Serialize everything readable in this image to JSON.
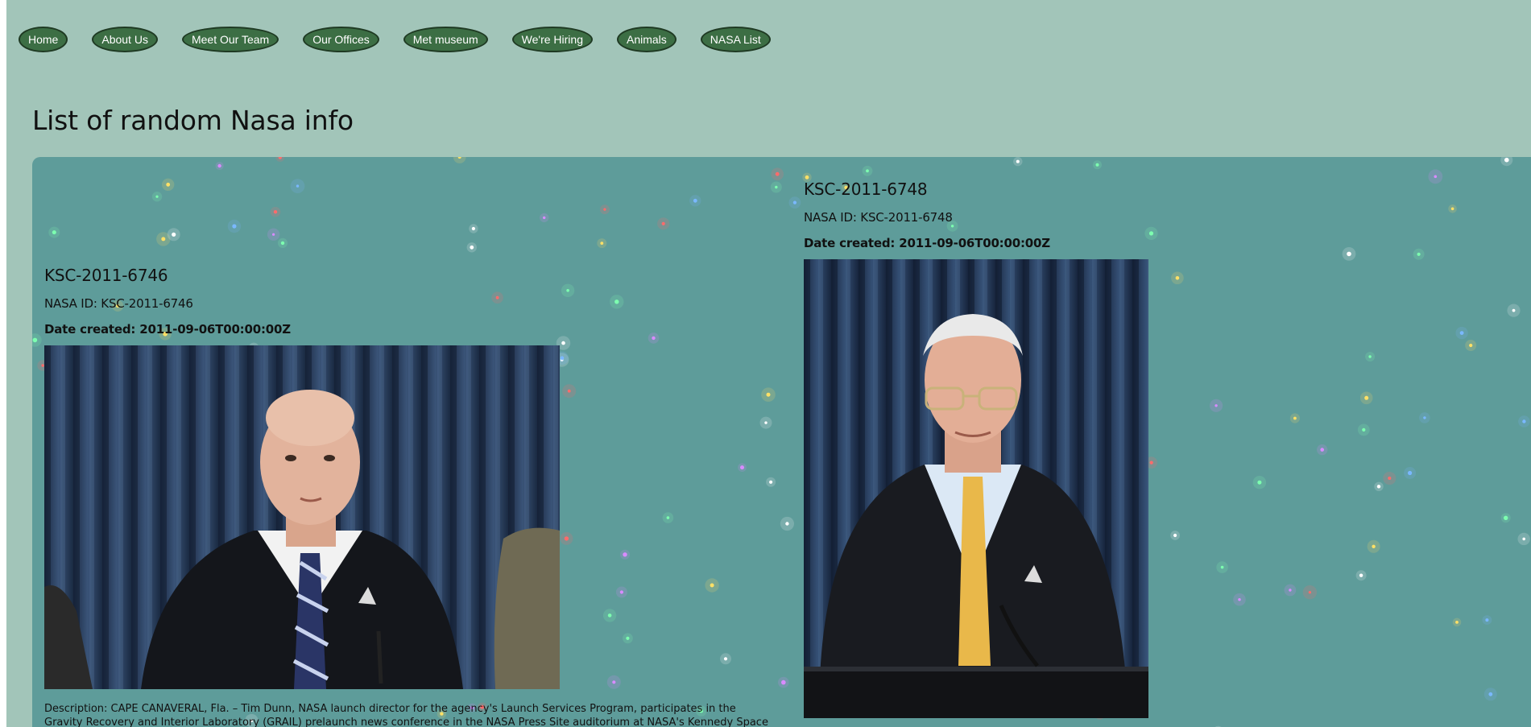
{
  "nav": {
    "items": [
      {
        "label": "Home",
        "name": "nav-home"
      },
      {
        "label": "About Us",
        "name": "nav-about-us"
      },
      {
        "label": "Meet Our Team",
        "name": "nav-meet-our-team"
      },
      {
        "label": "Our Offices",
        "name": "nav-our-offices"
      },
      {
        "label": "Met museum",
        "name": "nav-met-museum"
      },
      {
        "label": "We're Hiring",
        "name": "nav-were-hiring"
      },
      {
        "label": "Animals",
        "name": "nav-animals"
      },
      {
        "label": "NASA List",
        "name": "nav-nasa-list"
      }
    ]
  },
  "page": {
    "title": "List of random Nasa info"
  },
  "cards": [
    {
      "title": "KSC-2011-6746",
      "nasa_id": "NASA ID: KSC-2011-6746",
      "date_created": "Date created: 2011-09-06T00:00:00Z",
      "description": "Description: CAPE CANAVERAL, Fla. – Tim Dunn, NASA launch director for the agency's Launch Services Program, participates in the Gravity Recovery and Interior Laboratory (GRAIL) prelaunch news conference in the NASA Press Site auditorium at NASA's Kennedy Space Center in"
    },
    {
      "title": "KSC-2011-6748",
      "nasa_id": "NASA ID: KSC-2011-6748",
      "date_created": "Date created: 2011-09-06T00:00:00Z"
    }
  ],
  "colors": {
    "background": "#a2c5b9",
    "panel": "#5e9c9a",
    "nav_button": "#3c6e44",
    "sparkle_palette": [
      "#ffffff",
      "#7dffb0",
      "#ffe066",
      "#ff6b6b",
      "#d98bff",
      "#7ab8ff"
    ]
  }
}
